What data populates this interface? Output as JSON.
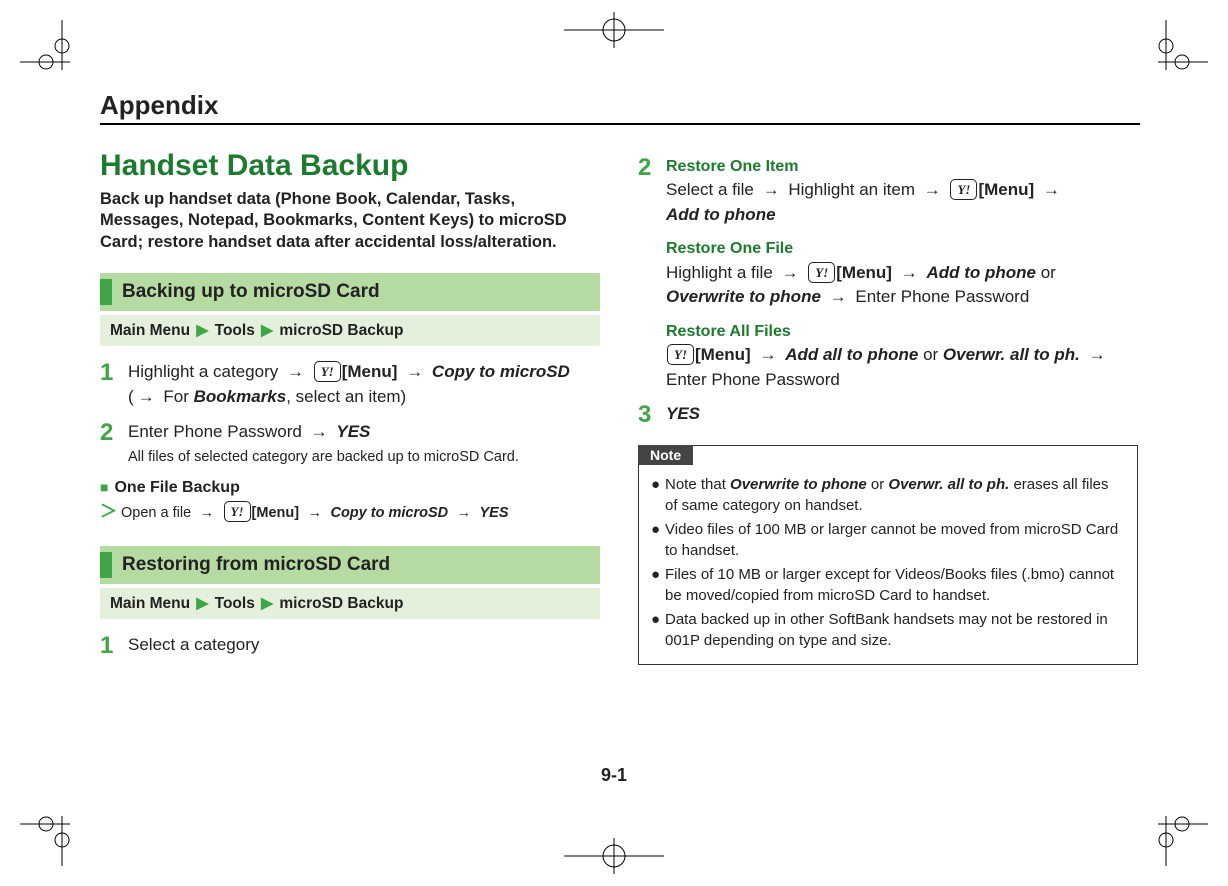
{
  "chapter": "Appendix",
  "sectionTitle": "Handset Data Backup",
  "intro": "Back up handset data (Phone Book, Calendar, Tasks, Messages, Notepad, Bookmarks, Content Keys) to microSD Card; restore handset data after accidental loss/alteration.",
  "backup": {
    "heading": "Backing up to microSD Card",
    "crumb": {
      "a": "Main Menu",
      "b": "Tools",
      "c": "microSD Backup"
    },
    "step1": {
      "t1": "Highlight a category",
      "menu": "[Menu]",
      "copy": "Copy to microSD",
      "t2": "(",
      "t3": " For ",
      "bookmarks": "Bookmarks",
      "t4": ", select an item)"
    },
    "step2": {
      "t1": "Enter Phone Password",
      "yes": "YES",
      "sub": "All files of selected category are backed up to microSD Card."
    },
    "oneFile": {
      "title": "One File Backup",
      "t1": "Open a file",
      "menu": "[Menu]",
      "copy": "Copy to microSD",
      "yes": "YES"
    }
  },
  "restore": {
    "heading": "Restoring from microSD Card",
    "crumb": {
      "a": "Main Menu",
      "b": "Tools",
      "c": "microSD Backup"
    },
    "step1": "Select a category",
    "step2": {
      "oneItemTitle": "Restore One Item",
      "t1": "Select a file",
      "t2": "Highlight an item",
      "menu": "[Menu]",
      "addPhone": "Add to phone",
      "oneFileTitle": "Restore One File",
      "f1": "Highlight a file",
      "or": " or ",
      "overwrite": "Overwrite to phone",
      "f2": "Enter Phone Password",
      "allTitle": "Restore All Files",
      "addAll": "Add all to phone",
      "overwrAll": "Overwr. all to ph.",
      "a2": "Enter Phone Password"
    },
    "step3": "YES"
  },
  "note": {
    "label": "Note",
    "i1a": "Note that ",
    "i1b": "Overwrite to phone",
    "i1c": " or ",
    "i1d": "Overwr. all to ph.",
    "i1e": " erases all files of same category on handset.",
    "i2": "Video files of 100 MB or larger cannot be moved from microSD Card to handset.",
    "i3": "Files of 10 MB or larger except for Videos/Books files (.bmo) cannot be moved/copied from microSD Card to handset.",
    "i4": "Data backed up in other SoftBank handsets may not be restored in 001P depending on type and size."
  },
  "pageNumber": "9-1",
  "glyph": {
    "arrow": "→",
    "tri": "▶",
    "key": "Y!"
  }
}
